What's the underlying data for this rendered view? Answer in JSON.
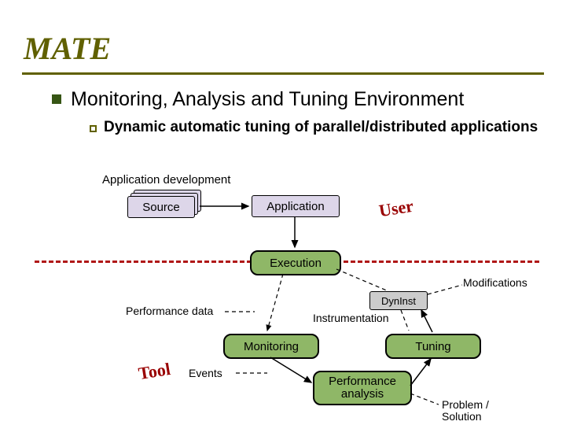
{
  "title": "MATE",
  "bullet1": "Monitoring, Analysis and Tuning Environment",
  "bullet2": "Dynamic automatic tuning of parallel/distributed applications",
  "labels": {
    "appdev": "Application development",
    "source": "Source",
    "application": "Application",
    "execution": "Execution",
    "user": "User",
    "modifications": "Modifications",
    "dyninst": "DynInst",
    "perfdata": "Performance data",
    "instrumentation": "Instrumentation",
    "monitoring": "Monitoring",
    "tuning": "Tuning",
    "tool": "Tool",
    "events": "Events",
    "perfanalysis_l1": "Performance",
    "perfanalysis_l2": "analysis",
    "problem_l1": "Problem /",
    "problem_l2": "Solution"
  }
}
